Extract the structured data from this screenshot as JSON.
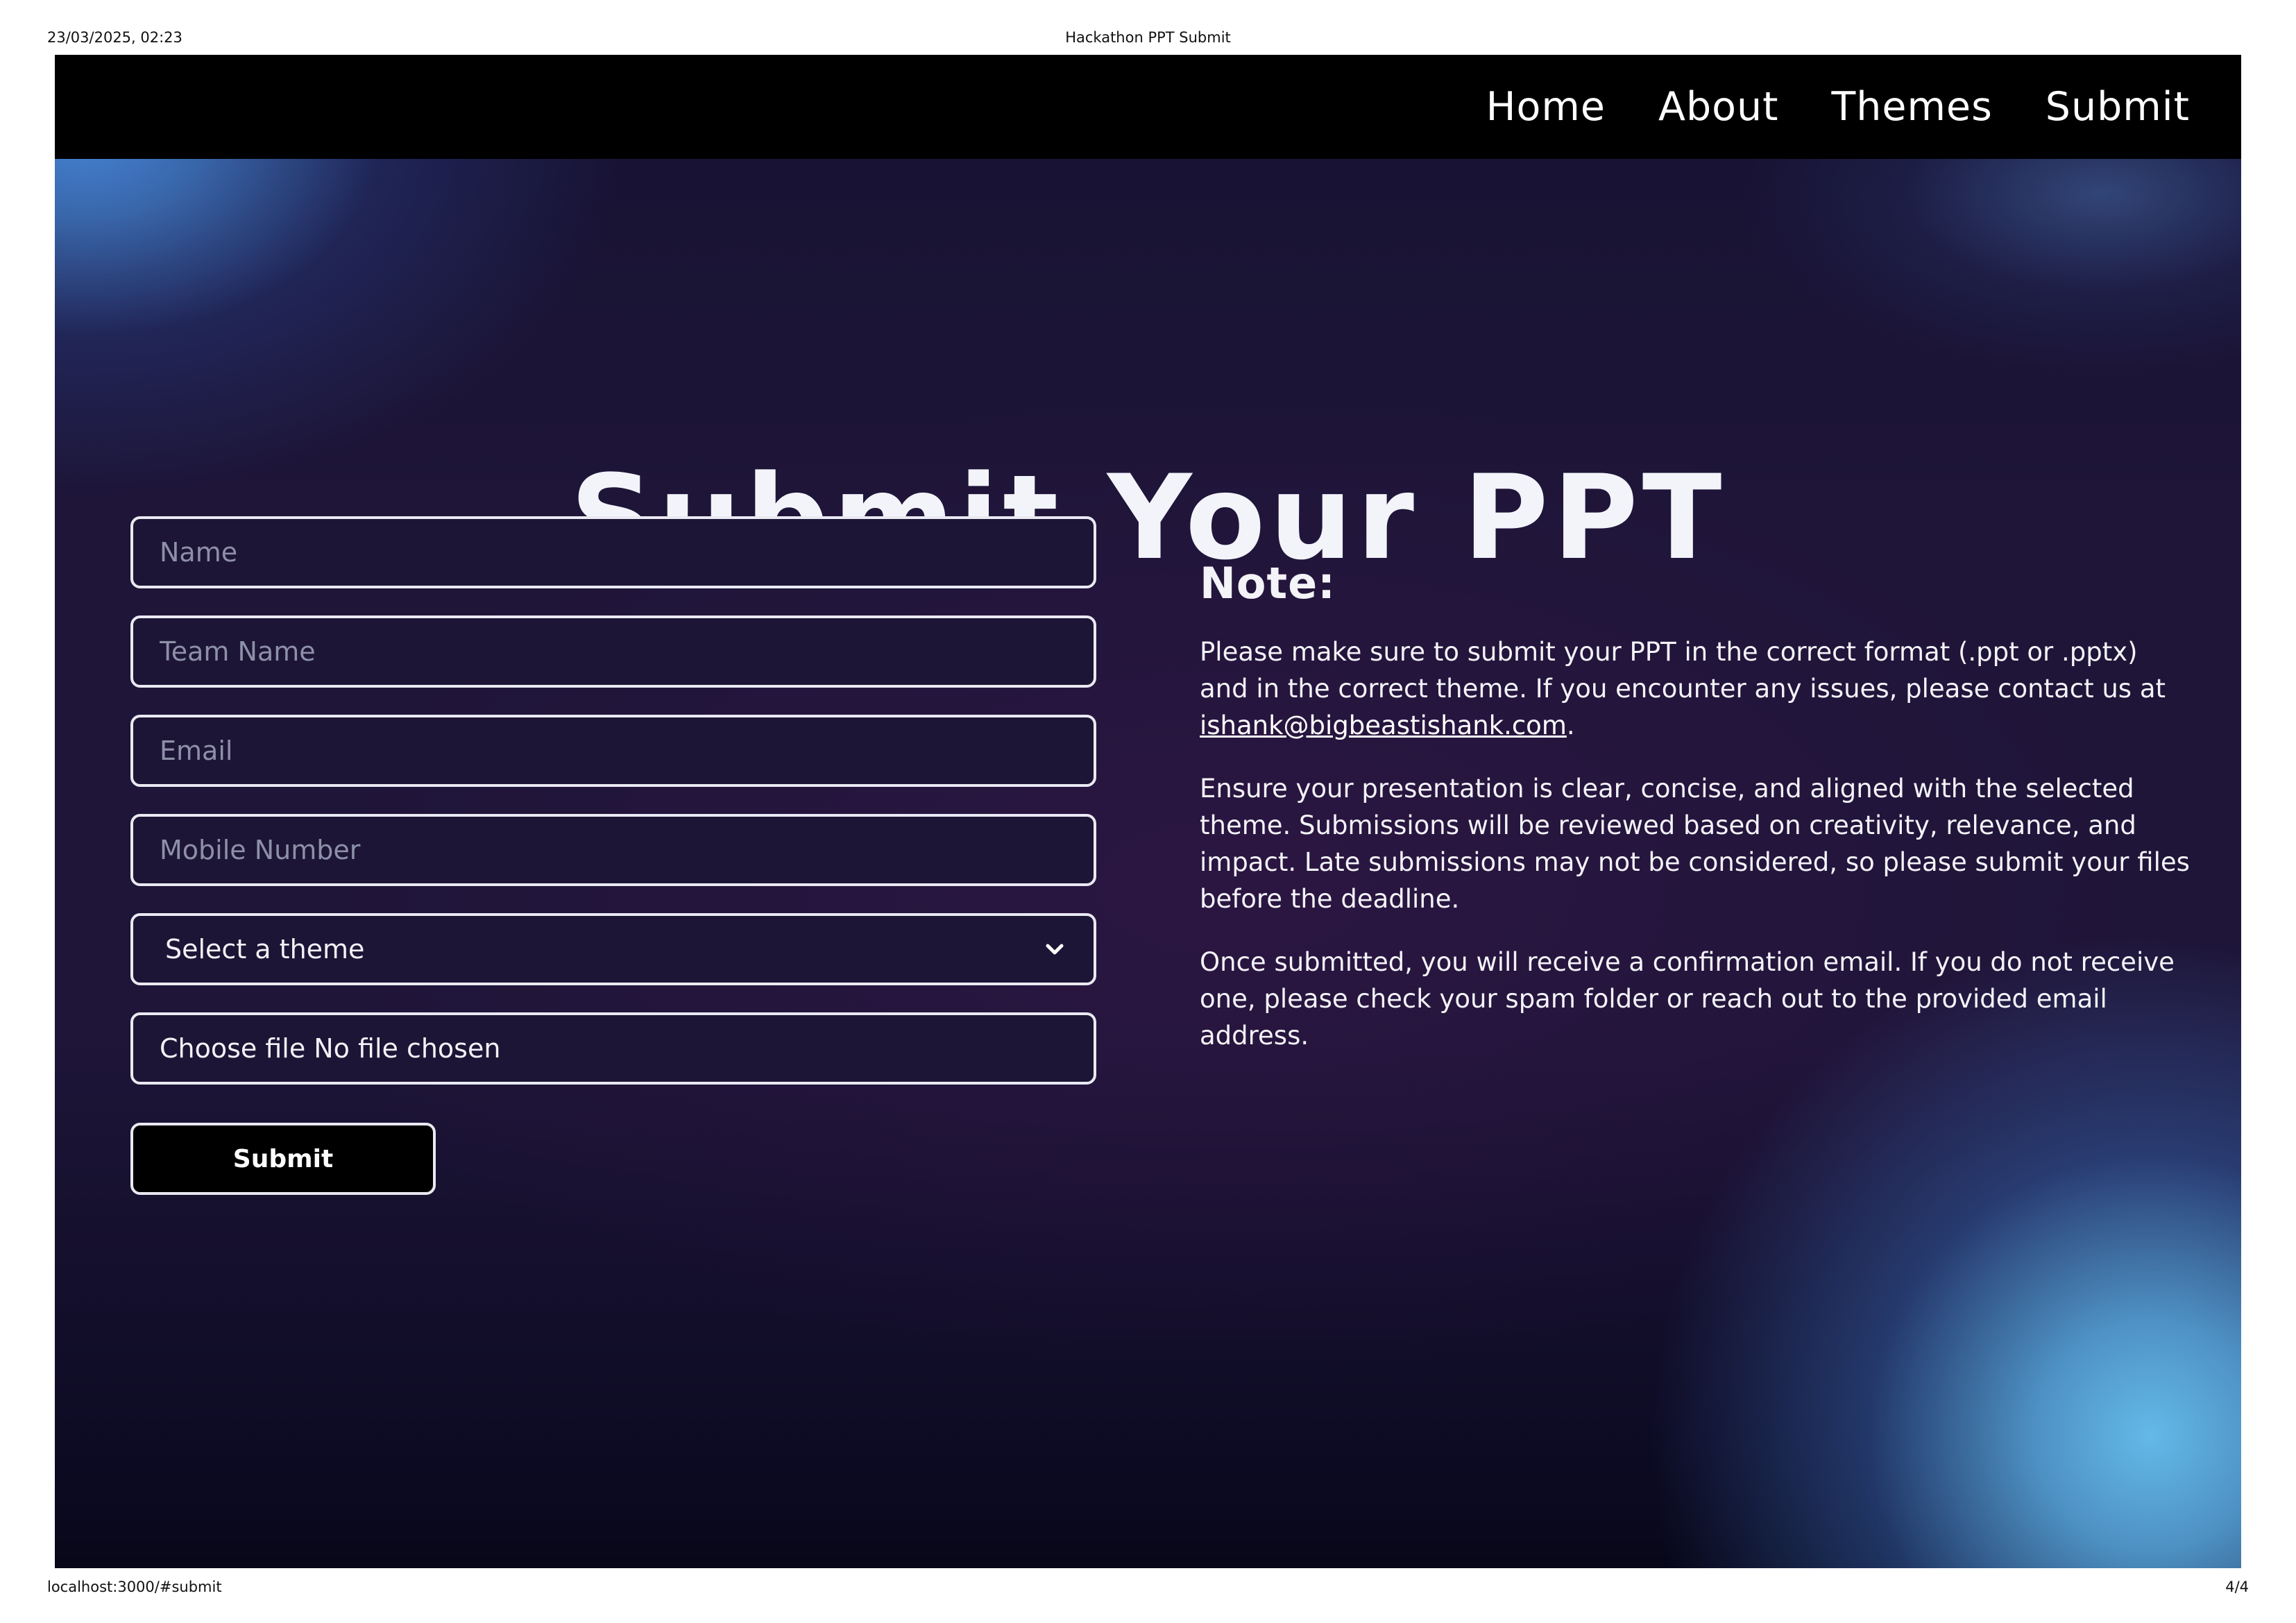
{
  "print": {
    "datetime": "23/03/2025, 02:23",
    "doc_title": "Hackathon PPT Submit",
    "url": "localhost:3000/#submit",
    "page": "4/4"
  },
  "nav": {
    "items": [
      {
        "label": "Home"
      },
      {
        "label": "About"
      },
      {
        "label": "Themes"
      },
      {
        "label": "Submit"
      }
    ]
  },
  "page_title": "Submit Your PPT",
  "form": {
    "name_placeholder": "Name",
    "team_placeholder": "Team Name",
    "email_placeholder": "Email",
    "mobile_placeholder": "Mobile Number",
    "theme_select": "Select a theme",
    "file_button": "Choose file",
    "file_status": "No file chosen",
    "submit_label": "Submit"
  },
  "note": {
    "heading": "Note:",
    "p1_text": "Please make sure to submit your PPT in the correct format (.ppt or .pptx) and in the correct theme. If you encounter any issues, please contact us at ",
    "p1_email": "ishank@bigbeastishank.com",
    "p1_end": ".",
    "p2": "Ensure your presentation is clear, concise, and aligned with the selected theme. Submissions will be reviewed based on creativity, relevance, and impact. Late submissions may not be considered, so please submit your files before the deadline.",
    "p3": "Once submitted, you will receive a confirmation email. If you do not receive one, please check your spam folder or reach out to the provided email address."
  },
  "colors": {
    "navbar": "#000000",
    "background": "#1e1438",
    "glow_blue": "#4482d2",
    "glow_cyan": "#63b9e7",
    "text": "#ffffff"
  },
  "icons": {
    "select_chevron": "chevron-down-icon"
  }
}
